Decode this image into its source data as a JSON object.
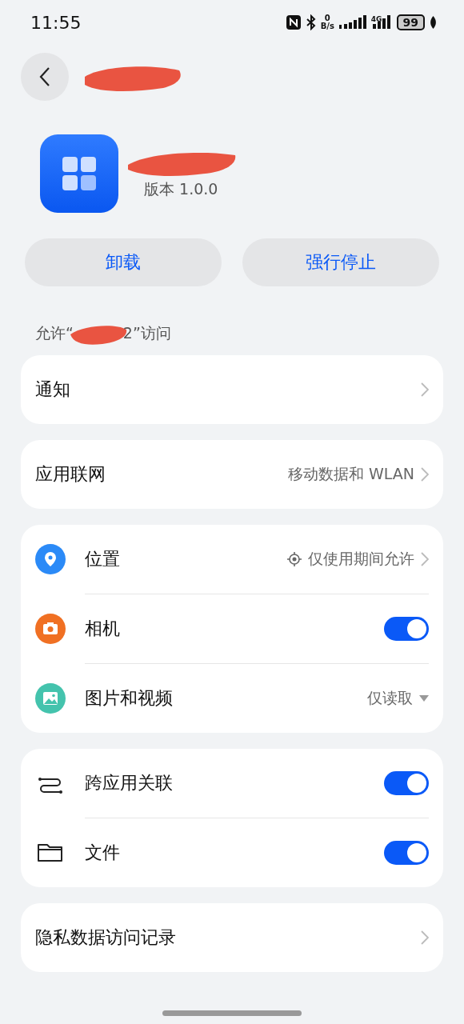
{
  "status_bar": {
    "time": "11:55",
    "net_speed_value": "0",
    "net_speed_unit": "B/s",
    "network": "4G",
    "battery": "99"
  },
  "app": {
    "version": "版本 1.0.0"
  },
  "actions": [
    "卸载",
    "强行停止"
  ],
  "access_label": {
    "prefix": "允许“",
    "suffix": "2”访问"
  },
  "groups": [
    [
      {
        "kind": "link",
        "label": "通知"
      }
    ],
    [
      {
        "kind": "link",
        "label": "应用联网",
        "value": "移动数据和 WLAN"
      }
    ],
    [
      {
        "kind": "link",
        "label": "位置",
        "value": "仅使用期间允许"
      },
      {
        "kind": "toggle",
        "label": "相机",
        "on": true
      },
      {
        "kind": "dropdown",
        "label": "图片和视频",
        "value": "仅读取"
      }
    ],
    [
      {
        "kind": "toggle",
        "label": "跨应用关联",
        "on": true
      },
      {
        "kind": "toggle",
        "label": "文件",
        "on": true
      }
    ],
    [
      {
        "kind": "link",
        "label": "隐私数据访问记录"
      }
    ]
  ]
}
